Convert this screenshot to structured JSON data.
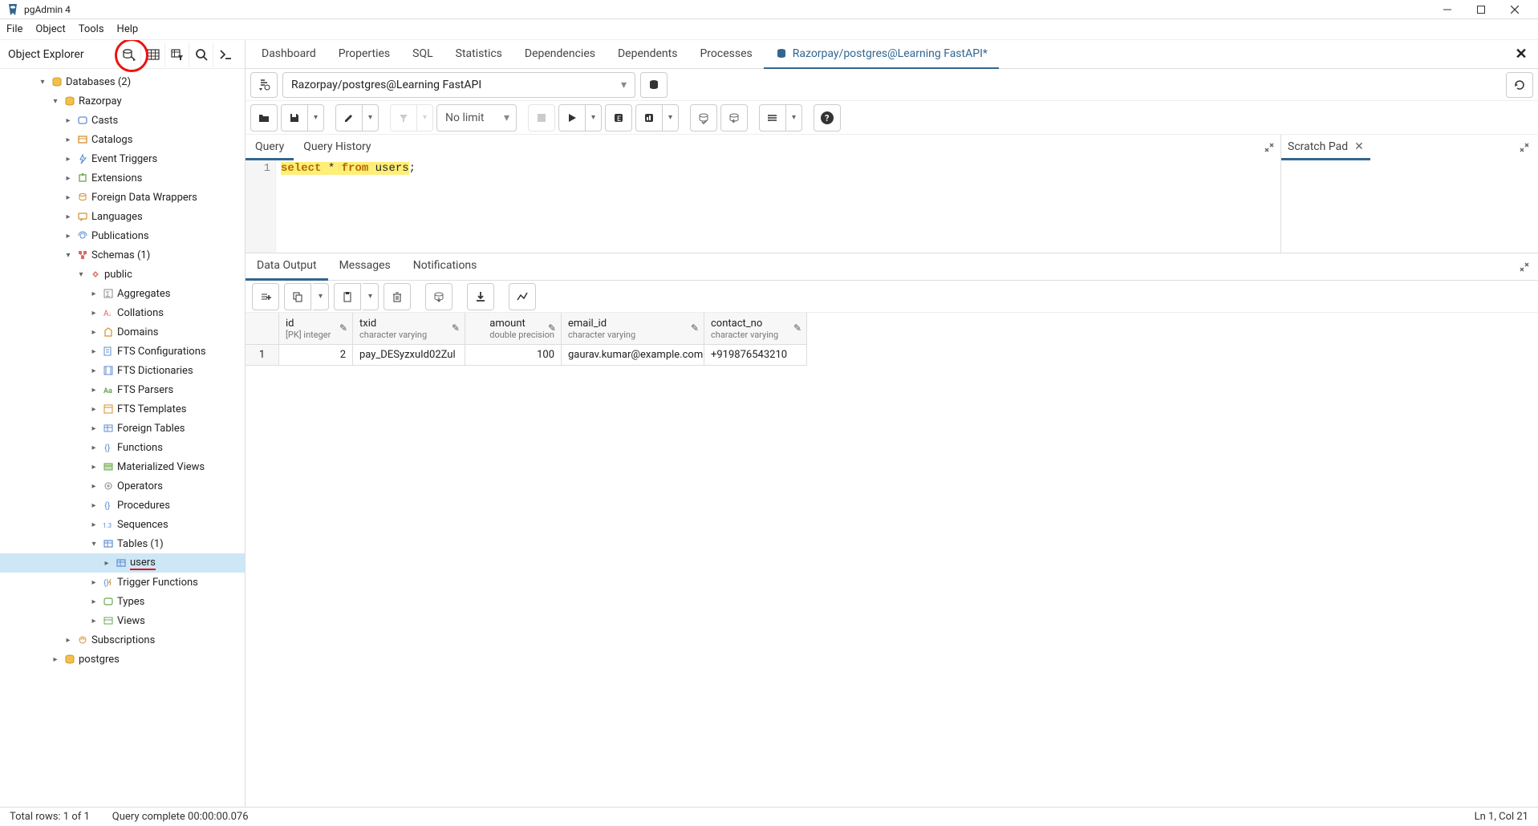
{
  "window": {
    "title": "pgAdmin 4"
  },
  "menubar": [
    "File",
    "Object",
    "Tools",
    "Help"
  ],
  "sidebar": {
    "title": "Object Explorer",
    "tree": {
      "databases": "Databases (2)",
      "db1": "Razorpay",
      "casts": "Casts",
      "catalogs": "Catalogs",
      "event_triggers": "Event Triggers",
      "extensions": "Extensions",
      "fdw": "Foreign Data Wrappers",
      "languages": "Languages",
      "publications": "Publications",
      "schemas": "Schemas (1)",
      "public": "public",
      "aggregates": "Aggregates",
      "collations": "Collations",
      "domains": "Domains",
      "fts_conf": "FTS Configurations",
      "fts_dict": "FTS Dictionaries",
      "fts_pars": "FTS Parsers",
      "fts_temp": "FTS Templates",
      "foreign_tables": "Foreign Tables",
      "functions": "Functions",
      "mat_views": "Materialized Views",
      "operators": "Operators",
      "procedures": "Procedures",
      "sequences": "Sequences",
      "tables": "Tables (1)",
      "users": "users",
      "trigger_fns": "Trigger Functions",
      "types": "Types",
      "views": "Views",
      "subscriptions": "Subscriptions",
      "db2": "postgres"
    }
  },
  "content_tabs": {
    "dashboard": "Dashboard",
    "properties": "Properties",
    "sql": "SQL",
    "statistics": "Statistics",
    "dependencies": "Dependencies",
    "dependents": "Dependents",
    "processes": "Processes",
    "active": "Razorpay/postgres@Learning FastAPI*"
  },
  "connection": {
    "value": "Razorpay/postgres@Learning FastAPI"
  },
  "toolbar": {
    "nolimit": "No limit"
  },
  "query_tabs": {
    "query": "Query",
    "history": "Query History"
  },
  "editor": {
    "line_no": "1",
    "kw1": "select",
    "star": " * ",
    "kw2": "from",
    "tbl": " users",
    "semi": ";"
  },
  "scratch": {
    "label": "Scratch Pad"
  },
  "output_tabs": {
    "data": "Data Output",
    "messages": "Messages",
    "notifications": "Notifications"
  },
  "columns": [
    {
      "name": "id",
      "type": "[PK] integer"
    },
    {
      "name": "txid",
      "type": "character varying"
    },
    {
      "name": "amount",
      "type": "double precision"
    },
    {
      "name": "email_id",
      "type": "character varying"
    },
    {
      "name": "contact_no",
      "type": "character varying"
    }
  ],
  "rows": [
    {
      "n": "1",
      "id": "2",
      "txid": "pay_DESyzxuId02Zul",
      "amount": "100",
      "email": "gaurav.kumar@example.com",
      "contact": "+919876543210"
    }
  ],
  "status": {
    "rows": "Total rows: 1 of 1",
    "complete": "Query complete 00:00:00.076",
    "pos": "Ln 1, Col 21"
  }
}
